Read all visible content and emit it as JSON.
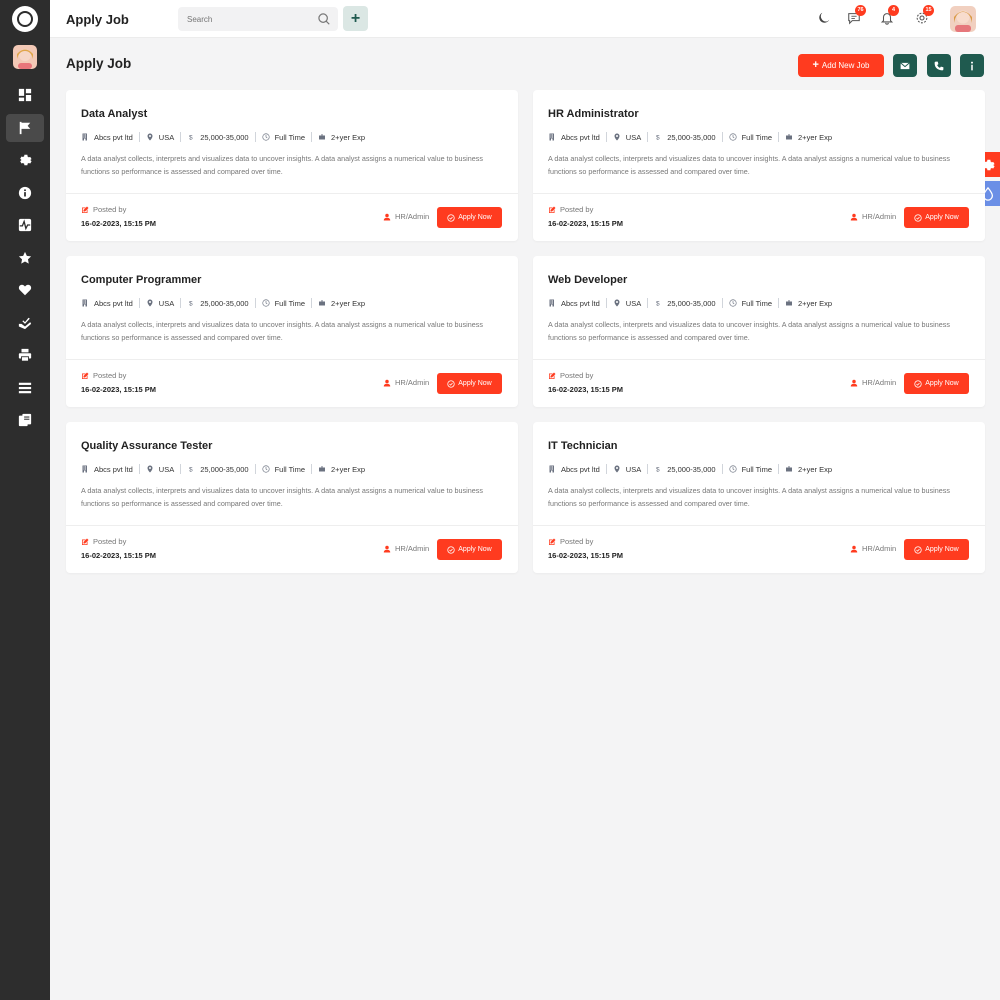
{
  "header": {
    "title": "Apply Job",
    "search_placeholder": "Search",
    "notifications": [
      {
        "icon": "chat-icon",
        "count": "76"
      },
      {
        "icon": "bell-icon",
        "count": "4"
      },
      {
        "icon": "gear-icon",
        "count": "15"
      }
    ]
  },
  "page": {
    "title": "Apply Job",
    "add_button": "Add New Job"
  },
  "sidebar": {
    "items": [
      {
        "icon": "dashboard-icon"
      },
      {
        "icon": "flag-icon",
        "active": true
      },
      {
        "icon": "gear-icon"
      },
      {
        "icon": "info-icon"
      },
      {
        "icon": "activity-icon"
      },
      {
        "icon": "star-icon"
      },
      {
        "icon": "heart-icon"
      },
      {
        "icon": "hand-check-icon"
      },
      {
        "icon": "printer-icon"
      },
      {
        "icon": "list-icon"
      },
      {
        "icon": "copy-icon"
      }
    ]
  },
  "colors": {
    "accent": "#ff3b1f",
    "teal": "#1f5a4f",
    "sidebar": "#2d2d2d"
  },
  "jobs": [
    {
      "title": "Data Analyst",
      "company": "Abcs pvt ltd",
      "location": "USA",
      "salary": "25,000-35,000",
      "type": "Full Time",
      "experience": "2+yer Exp",
      "description": "A data analyst collects, interprets and visualizes data to uncover insights. A data analyst assigns a numerical value to business functions so performance is assessed and compared over time.",
      "posted_label": "Posted by",
      "posted_date": "16-02-2023, 15:15 PM",
      "owner": "HR/Admin",
      "apply_label": "Apply Now"
    },
    {
      "title": "HR Administrator",
      "company": "Abcs pvt ltd",
      "location": "USA",
      "salary": "25,000-35,000",
      "type": "Full Time",
      "experience": "2+yer Exp",
      "description": "A data analyst collects, interprets and visualizes data to uncover insights. A data analyst assigns a numerical value to business functions so performance is assessed and compared over time.",
      "posted_label": "Posted by",
      "posted_date": "16-02-2023, 15:15 PM",
      "owner": "HR/Admin",
      "apply_label": "Apply Now"
    },
    {
      "title": "Computer Programmer",
      "company": "Abcs pvt ltd",
      "location": "USA",
      "salary": "25,000-35,000",
      "type": "Full Time",
      "experience": "2+yer Exp",
      "description": "A data analyst collects, interprets and visualizes data to uncover insights. A data analyst assigns a numerical value to business functions so performance is assessed and compared over time.",
      "posted_label": "Posted by",
      "posted_date": "16-02-2023, 15:15 PM",
      "owner": "HR/Admin",
      "apply_label": "Apply Now"
    },
    {
      "title": "Web Developer",
      "company": "Abcs pvt ltd",
      "location": "USA",
      "salary": "25,000-35,000",
      "type": "Full Time",
      "experience": "2+yer Exp",
      "description": "A data analyst collects, interprets and visualizes data to uncover insights. A data analyst assigns a numerical value to business functions so performance is assessed and compared over time.",
      "posted_label": "Posted by",
      "posted_date": "16-02-2023, 15:15 PM",
      "owner": "HR/Admin",
      "apply_label": "Apply Now"
    },
    {
      "title": "Quality Assurance Tester",
      "company": "Abcs pvt ltd",
      "location": "USA",
      "salary": "25,000-35,000",
      "type": "Full Time",
      "experience": "2+yer Exp",
      "description": "A data analyst collects, interprets and visualizes data to uncover insights. A data analyst assigns a numerical value to business functions so performance is assessed and compared over time.",
      "posted_label": "Posted by",
      "posted_date": "16-02-2023, 15:15 PM",
      "owner": "HR/Admin",
      "apply_label": "Apply Now"
    },
    {
      "title": "IT Technician",
      "company": "Abcs pvt ltd",
      "location": "USA",
      "salary": "25,000-35,000",
      "type": "Full Time",
      "experience": "2+yer Exp",
      "description": "A data analyst collects, interprets and visualizes data to uncover insights. A data analyst assigns a numerical value to business functions so performance is assessed and compared over time.",
      "posted_label": "Posted by",
      "posted_date": "16-02-2023, 15:15 PM",
      "owner": "HR/Admin",
      "apply_label": "Apply Now"
    }
  ]
}
